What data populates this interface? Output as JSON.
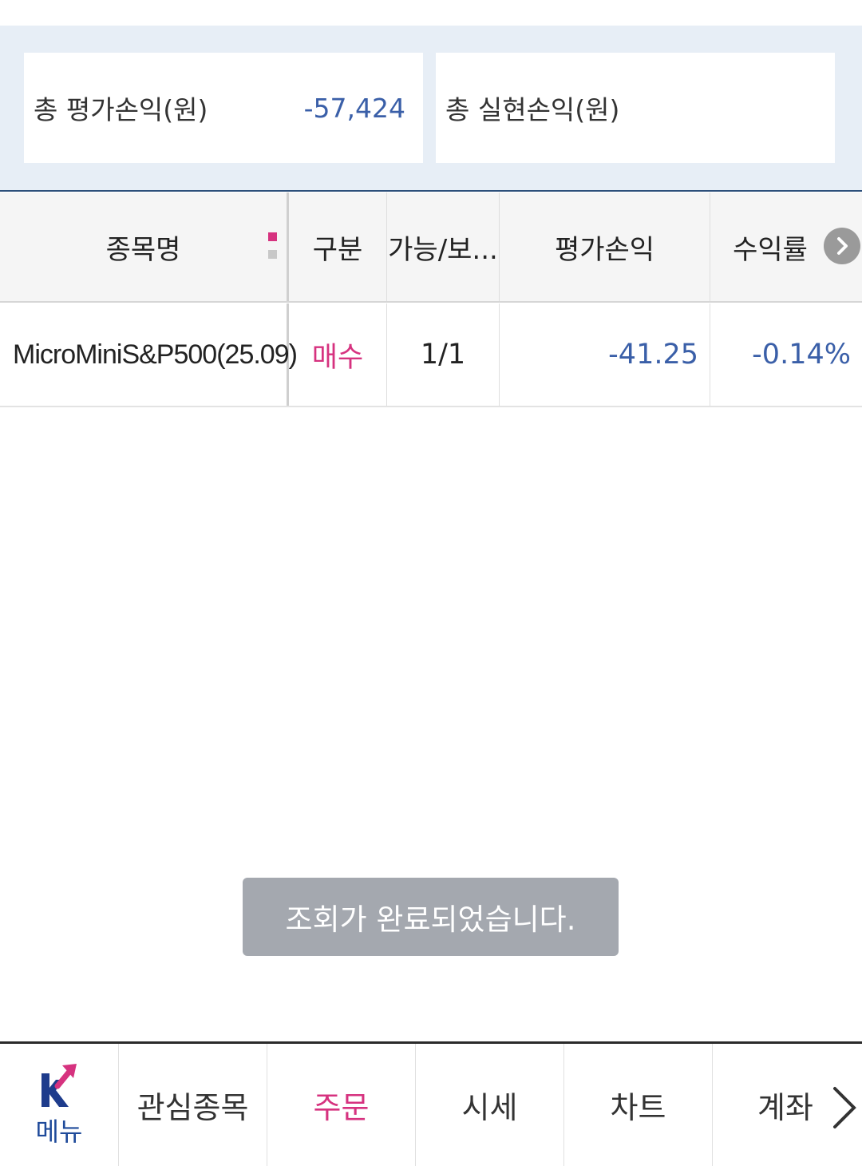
{
  "summary": {
    "total_eval_label": "총 평가손익(원)",
    "total_eval_value": "-57,424",
    "total_realized_label": "총 실현손익(원)",
    "total_realized_value": ""
  },
  "table": {
    "headers": {
      "name": "종목명",
      "type": "구분",
      "qty": "가능/보...",
      "pl": "평가손익",
      "rate": "수익률"
    },
    "rows": [
      {
        "name": "MicroMiniS&P500(25.09)",
        "type": "매수",
        "qty": "1/1",
        "pl": "-41.25",
        "rate": "-0.14%"
      }
    ]
  },
  "toast": {
    "message": "조회가 완료되었습니다."
  },
  "bottom_nav": {
    "menu_label": "메뉴",
    "items": [
      "관심종목",
      "주문",
      "시세",
      "차트",
      "계좌"
    ]
  },
  "colors": {
    "accent_pink": "#d6327f",
    "value_blue": "#3a5fa8",
    "summary_bg": "#e7eef6"
  }
}
